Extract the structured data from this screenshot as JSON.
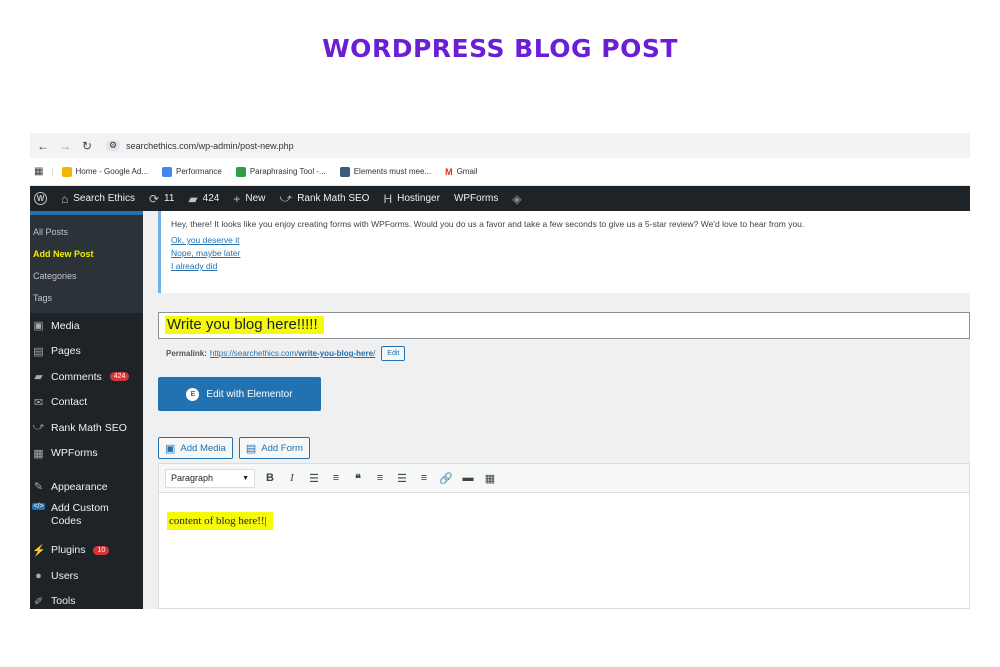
{
  "page_title": "WORDPRESS BLOG POST",
  "browser": {
    "url": "searchethics.com/wp-admin/post-new.php",
    "bookmarks": [
      {
        "label": "Home - Google Ad...",
        "color": "#f4b400"
      },
      {
        "label": "Performance",
        "color": "#4285f4"
      },
      {
        "label": "Paraphrasing Tool -...",
        "color": "#2e9e44"
      },
      {
        "label": "Elements must mee...",
        "color": "#3b5b7a"
      },
      {
        "label": "Gmail",
        "color": "#d93025"
      }
    ]
  },
  "admin_bar": {
    "site_name": "Search Ethics",
    "updates": "11",
    "comments": "424",
    "new": "New",
    "rank_math": "Rank Math SEO",
    "hostinger": "Hostinger",
    "wpforms": "WPForms"
  },
  "sidebar": {
    "submenu": [
      {
        "label": "All Posts"
      },
      {
        "label": "Add New Post"
      },
      {
        "label": "Categories"
      },
      {
        "label": "Tags"
      }
    ],
    "items": [
      {
        "label": "Media",
        "icon": "media-icon"
      },
      {
        "label": "Pages",
        "icon": "pages-icon"
      },
      {
        "label": "Comments",
        "icon": "comments-icon",
        "badge": "424"
      },
      {
        "label": "Contact",
        "icon": "mail-icon"
      },
      {
        "label": "Rank Math SEO",
        "icon": "rank-math-icon"
      },
      {
        "label": "WPForms",
        "icon": "wpforms-icon"
      },
      {
        "label": "Appearance",
        "icon": "appearance-icon"
      },
      {
        "label": "Add Custom Codes",
        "icon": "code-icon"
      },
      {
        "label": "Plugins",
        "icon": "plugins-icon",
        "badge": "10"
      },
      {
        "label": "Users",
        "icon": "users-icon"
      },
      {
        "label": "Tools",
        "icon": "tools-icon"
      }
    ]
  },
  "notice": {
    "message": "Hey, there! It looks like you enjoy creating forms with WPForms. Would you do us a favor and take a few seconds to give us a 5-star review? We'd love to hear from you.",
    "links": [
      "Ok, you deserve it",
      "Nope, maybe later",
      "I already did"
    ]
  },
  "post": {
    "title": "Write you blog here!!!!!",
    "permalink_label": "Permalink:",
    "permalink_url_prefix": "https://searchethics.com/",
    "permalink_slug": "write-you-blog-here",
    "permalink_suffix": "/",
    "edit_label": "Edit",
    "elementor_label": "Edit with Elementor",
    "add_media_label": "Add Media",
    "add_form_label": "Add Form",
    "format_value": "Paragraph",
    "content": "content of blog here!!|"
  },
  "colors": {
    "title_purple": "#6a1fd6",
    "highlight": "#f7f90a",
    "wp_blue": "#2271b1",
    "admin_dark": "#1d2327"
  }
}
